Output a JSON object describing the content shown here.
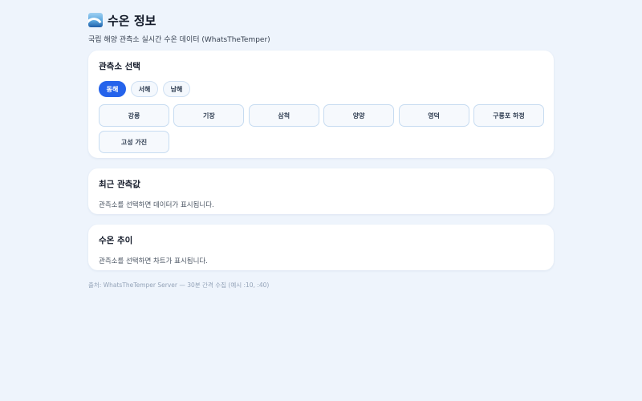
{
  "header": {
    "title": "수온 정보",
    "subtitle": "국립 해양 관측소 실시간 수온 데이터 (WhatsTheTemper)"
  },
  "station_select": {
    "title": "관측소 선택",
    "regions": [
      {
        "label": "동해",
        "active": true
      },
      {
        "label": "서해",
        "active": false
      },
      {
        "label": "남해",
        "active": false
      }
    ],
    "stations": [
      "강릉",
      "기장",
      "삼척",
      "양양",
      "영덕",
      "구룡포 하정",
      "고성 가진"
    ]
  },
  "latest": {
    "title": "최근 관측값",
    "message": "관측소를 선택하면 데이터가 표시됩니다."
  },
  "trend": {
    "title": "수온 추이",
    "message": "관측소를 선택하면 차트가 표시됩니다."
  },
  "footer": {
    "text": "출처: WhatsTheTemper Server — 30분 간격 수집 (예시 :10, :40)"
  },
  "colors": {
    "accent": "#2563eb",
    "background": "#eef4fc"
  }
}
